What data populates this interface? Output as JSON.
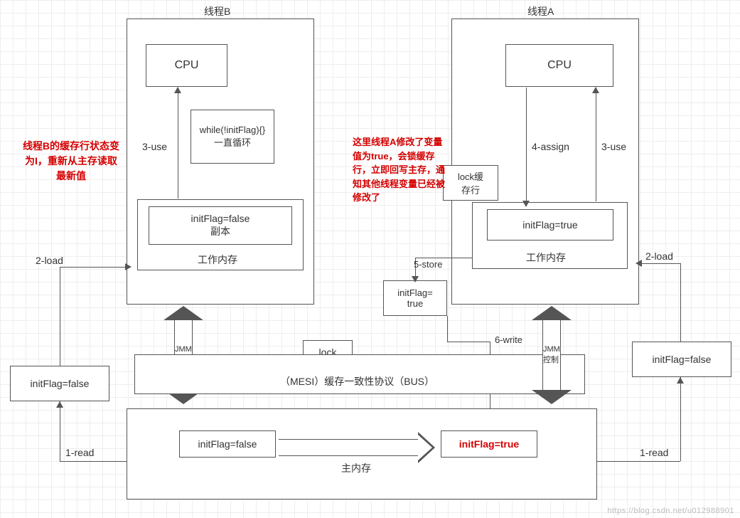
{
  "titles": {
    "threadB": "线程B",
    "threadA": "线程A"
  },
  "cpu": {
    "b": "CPU",
    "a": "CPU"
  },
  "whileBox": "while(!initFlag){}\n一直循环",
  "copyBoxB": "initFlag=false\n副本",
  "workMemB": "工作内存",
  "copyBoxA": "initFlag=true",
  "workMemA": "工作内存",
  "lockCache": "lock缓\n存行",
  "storeBox": "initFlag=\ntrue",
  "lockBox": "lock",
  "busLabel": "（MESI）缓存一致性协议（BUS）",
  "mainMem": {
    "left": "initFlag=false",
    "right": "initFlag=true",
    "label": "主内存"
  },
  "sideBoxLeft": "initFlag=false",
  "sideBoxRight": "initFlag=false",
  "redNoteLeft": "线程B的缓存行状态变为I，重新从主存读取最新值",
  "redNoteRight": "这里线程A修改了变量值为true，会锁缓存行，立即回写主存，通知其他线程变量已经被修改了",
  "ops": {
    "load_l": "2-load",
    "use_l": "3-use",
    "load_r": "2-load",
    "use_r": "3-use",
    "assign": "4-assign",
    "store": "5-store",
    "write": "6-write",
    "read_l": "1-read",
    "read_r": "1-read"
  },
  "jmm": "JMM控制",
  "watermark": "https://blog.csdn.net/u012988901"
}
